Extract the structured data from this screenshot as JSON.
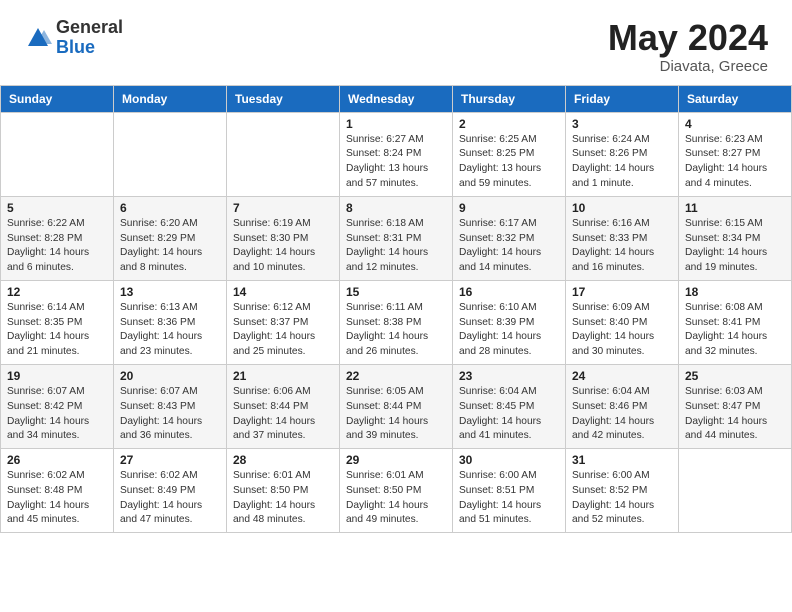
{
  "header": {
    "logo_general": "General",
    "logo_blue": "Blue",
    "month_title": "May 2024",
    "subtitle": "Diavata, Greece"
  },
  "days_of_week": [
    "Sunday",
    "Monday",
    "Tuesday",
    "Wednesday",
    "Thursday",
    "Friday",
    "Saturday"
  ],
  "weeks": [
    [
      {
        "num": "",
        "info": ""
      },
      {
        "num": "",
        "info": ""
      },
      {
        "num": "",
        "info": ""
      },
      {
        "num": "1",
        "info": "Sunrise: 6:27 AM\nSunset: 8:24 PM\nDaylight: 13 hours and 57 minutes."
      },
      {
        "num": "2",
        "info": "Sunrise: 6:25 AM\nSunset: 8:25 PM\nDaylight: 13 hours and 59 minutes."
      },
      {
        "num": "3",
        "info": "Sunrise: 6:24 AM\nSunset: 8:26 PM\nDaylight: 14 hours and 1 minute."
      },
      {
        "num": "4",
        "info": "Sunrise: 6:23 AM\nSunset: 8:27 PM\nDaylight: 14 hours and 4 minutes."
      }
    ],
    [
      {
        "num": "5",
        "info": "Sunrise: 6:22 AM\nSunset: 8:28 PM\nDaylight: 14 hours and 6 minutes."
      },
      {
        "num": "6",
        "info": "Sunrise: 6:20 AM\nSunset: 8:29 PM\nDaylight: 14 hours and 8 minutes."
      },
      {
        "num": "7",
        "info": "Sunrise: 6:19 AM\nSunset: 8:30 PM\nDaylight: 14 hours and 10 minutes."
      },
      {
        "num": "8",
        "info": "Sunrise: 6:18 AM\nSunset: 8:31 PM\nDaylight: 14 hours and 12 minutes."
      },
      {
        "num": "9",
        "info": "Sunrise: 6:17 AM\nSunset: 8:32 PM\nDaylight: 14 hours and 14 minutes."
      },
      {
        "num": "10",
        "info": "Sunrise: 6:16 AM\nSunset: 8:33 PM\nDaylight: 14 hours and 16 minutes."
      },
      {
        "num": "11",
        "info": "Sunrise: 6:15 AM\nSunset: 8:34 PM\nDaylight: 14 hours and 19 minutes."
      }
    ],
    [
      {
        "num": "12",
        "info": "Sunrise: 6:14 AM\nSunset: 8:35 PM\nDaylight: 14 hours and 21 minutes."
      },
      {
        "num": "13",
        "info": "Sunrise: 6:13 AM\nSunset: 8:36 PM\nDaylight: 14 hours and 23 minutes."
      },
      {
        "num": "14",
        "info": "Sunrise: 6:12 AM\nSunset: 8:37 PM\nDaylight: 14 hours and 25 minutes."
      },
      {
        "num": "15",
        "info": "Sunrise: 6:11 AM\nSunset: 8:38 PM\nDaylight: 14 hours and 26 minutes."
      },
      {
        "num": "16",
        "info": "Sunrise: 6:10 AM\nSunset: 8:39 PM\nDaylight: 14 hours and 28 minutes."
      },
      {
        "num": "17",
        "info": "Sunrise: 6:09 AM\nSunset: 8:40 PM\nDaylight: 14 hours and 30 minutes."
      },
      {
        "num": "18",
        "info": "Sunrise: 6:08 AM\nSunset: 8:41 PM\nDaylight: 14 hours and 32 minutes."
      }
    ],
    [
      {
        "num": "19",
        "info": "Sunrise: 6:07 AM\nSunset: 8:42 PM\nDaylight: 14 hours and 34 minutes."
      },
      {
        "num": "20",
        "info": "Sunrise: 6:07 AM\nSunset: 8:43 PM\nDaylight: 14 hours and 36 minutes."
      },
      {
        "num": "21",
        "info": "Sunrise: 6:06 AM\nSunset: 8:44 PM\nDaylight: 14 hours and 37 minutes."
      },
      {
        "num": "22",
        "info": "Sunrise: 6:05 AM\nSunset: 8:44 PM\nDaylight: 14 hours and 39 minutes."
      },
      {
        "num": "23",
        "info": "Sunrise: 6:04 AM\nSunset: 8:45 PM\nDaylight: 14 hours and 41 minutes."
      },
      {
        "num": "24",
        "info": "Sunrise: 6:04 AM\nSunset: 8:46 PM\nDaylight: 14 hours and 42 minutes."
      },
      {
        "num": "25",
        "info": "Sunrise: 6:03 AM\nSunset: 8:47 PM\nDaylight: 14 hours and 44 minutes."
      }
    ],
    [
      {
        "num": "26",
        "info": "Sunrise: 6:02 AM\nSunset: 8:48 PM\nDaylight: 14 hours and 45 minutes."
      },
      {
        "num": "27",
        "info": "Sunrise: 6:02 AM\nSunset: 8:49 PM\nDaylight: 14 hours and 47 minutes."
      },
      {
        "num": "28",
        "info": "Sunrise: 6:01 AM\nSunset: 8:50 PM\nDaylight: 14 hours and 48 minutes."
      },
      {
        "num": "29",
        "info": "Sunrise: 6:01 AM\nSunset: 8:50 PM\nDaylight: 14 hours and 49 minutes."
      },
      {
        "num": "30",
        "info": "Sunrise: 6:00 AM\nSunset: 8:51 PM\nDaylight: 14 hours and 51 minutes."
      },
      {
        "num": "31",
        "info": "Sunrise: 6:00 AM\nSunset: 8:52 PM\nDaylight: 14 hours and 52 minutes."
      },
      {
        "num": "",
        "info": ""
      }
    ]
  ]
}
